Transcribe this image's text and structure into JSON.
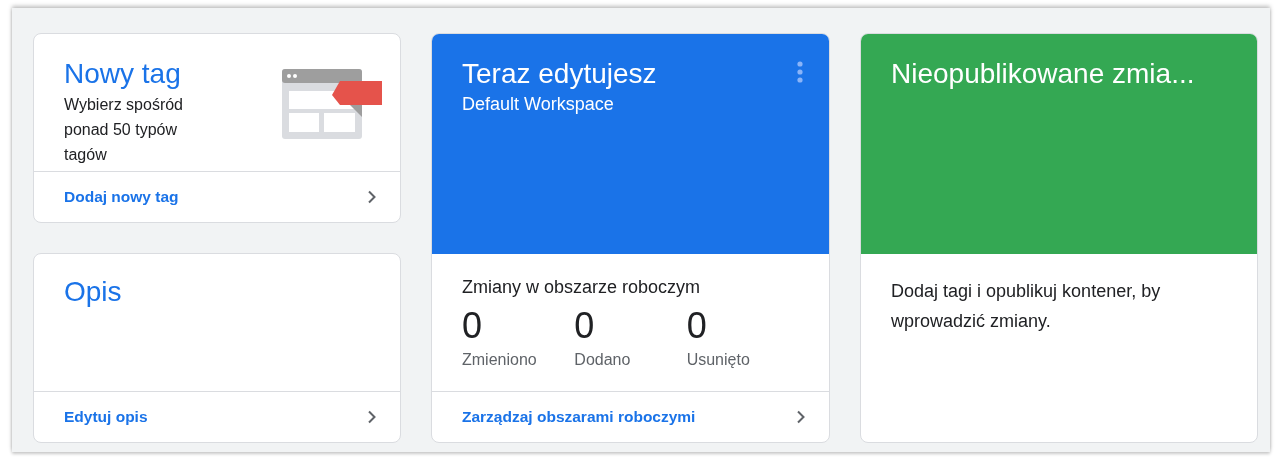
{
  "new_tag": {
    "title": "Nowy tag",
    "description": "Wybierz spośród ponad 50 typów tagów",
    "link": "Dodaj nowy tag"
  },
  "description_card": {
    "title": "Opis",
    "link": "Edytuj opis"
  },
  "workspace": {
    "title": "Teraz edytujesz",
    "subtitle": "Default Workspace",
    "changes_heading": "Zmiany w obszarze roboczym",
    "stats": [
      {
        "value": "0",
        "label": "Zmieniono"
      },
      {
        "value": "0",
        "label": "Dodano"
      },
      {
        "value": "0",
        "label": "Usunięto"
      }
    ],
    "link": "Zarządzaj obszarami roboczymi"
  },
  "unpublished": {
    "title": "Nieopublikowane zmia...",
    "message": "Dodaj tagi i opublikuj kontener, by wprowadzić zmiany."
  }
}
